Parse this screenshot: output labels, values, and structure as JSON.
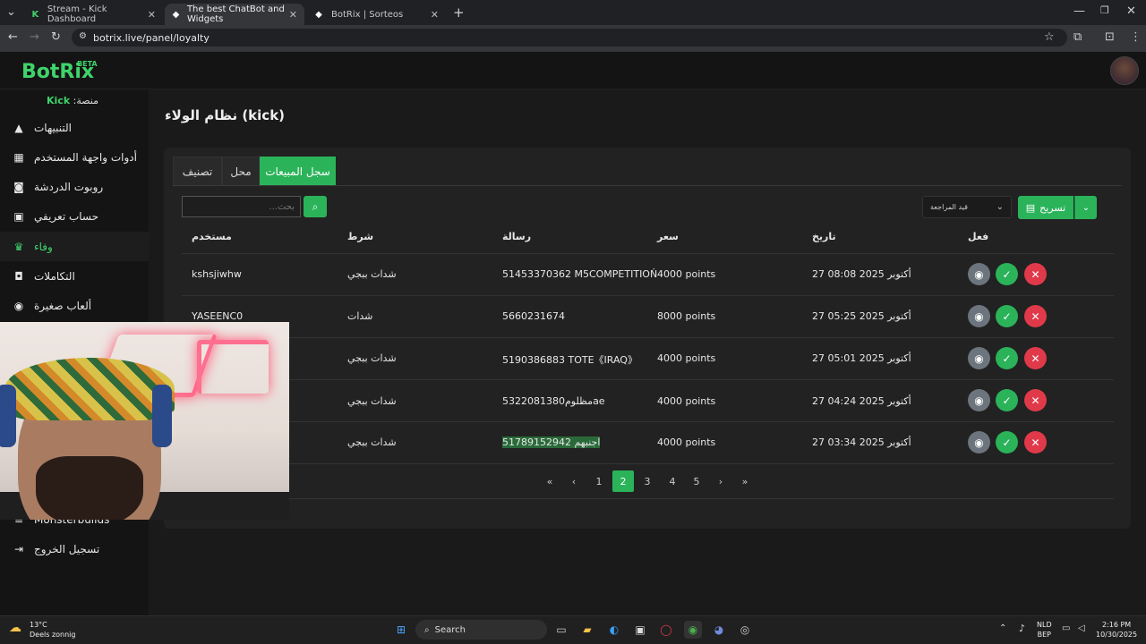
{
  "browser": {
    "tabs": [
      {
        "label": "Stream - Kick Dashboard",
        "icon": "kick-icon"
      },
      {
        "label": "The best ChatBot and Widgets",
        "icon": "botrix-icon"
      },
      {
        "label": "BotRix | Sorteos",
        "icon": "botrix-icon"
      }
    ],
    "url": "botrix.live/panel/loyalty"
  },
  "app": {
    "logo": "BotRix",
    "beta": "BETA",
    "platform_label": "منصة:",
    "platform_value": "Kick"
  },
  "sidebar": {
    "items": [
      {
        "label": "التنبيهات",
        "icon": "alert-icon"
      },
      {
        "label": "أدوات واجهة المستخدم",
        "icon": "widgets-icon"
      },
      {
        "label": "روبوت الدردشة",
        "icon": "robot-icon"
      },
      {
        "label": "حساب تعريفي",
        "icon": "profile-card-icon"
      },
      {
        "label": "وفاء",
        "icon": "trophy-icon",
        "active": true
      },
      {
        "label": "التكاملات",
        "icon": "integrations-icon"
      },
      {
        "label": "ألعاب صغيرة",
        "icon": "gamepad-icon"
      },
      {
        "label": "Monsterbuilds",
        "icon": "list-icon"
      },
      {
        "label": "تسجيل الخروج",
        "icon": "logout-icon"
      }
    ]
  },
  "main": {
    "title": "نظام الولاء (kick)",
    "tabs": [
      "سجل المبيعات",
      "محل",
      "تصنيف"
    ],
    "search_placeholder": "بحث...",
    "filter_label": "قيد المراجعة",
    "export_label": "تسريح",
    "columns": {
      "user": "مستخدم",
      "condition": "شرط",
      "message": "رسالة",
      "price": "سعر",
      "date": "تاريخ",
      "action": "فعل"
    },
    "rows": [
      {
        "user": "kshsjiwhw",
        "condition": "شدات ببجي",
        "message": "51453370362 M5COMPETITIOŃ",
        "price": "4000 points",
        "date": "27 أكتوبر 2025 08:08"
      },
      {
        "user": "YASEENC0",
        "condition": "شدات",
        "message": "5660231674",
        "price": "8000 points",
        "date": "27 أكتوبر 2025 05:25"
      },
      {
        "user": "",
        "condition": "شدات ببجي",
        "message": "5190386883 TOTE《IRAQ》",
        "price": "4000 points",
        "date": "27 أكتوبر 2025 05:01"
      },
      {
        "user": "",
        "condition": "شدات ببجي",
        "message": "5322081380مظلومae",
        "price": "4000 points",
        "date": "27 أكتوبر 2025 04:24"
      },
      {
        "user": "",
        "condition": "شدات ببجي",
        "message": "51789152942 اجنبهم",
        "price": "4000 points",
        "date": "27 أكتوبر 2025 03:34"
      }
    ],
    "pagination": {
      "pages": [
        "1",
        "2",
        "3",
        "4",
        "5"
      ],
      "current": "2"
    }
  },
  "taskbar": {
    "temperature": "13°C",
    "weather": "Deels zonnig",
    "search": "Search",
    "lang_top": "NLD",
    "lang_bottom": "BEP",
    "time": "2:16 PM",
    "date": "10/30/2025"
  }
}
